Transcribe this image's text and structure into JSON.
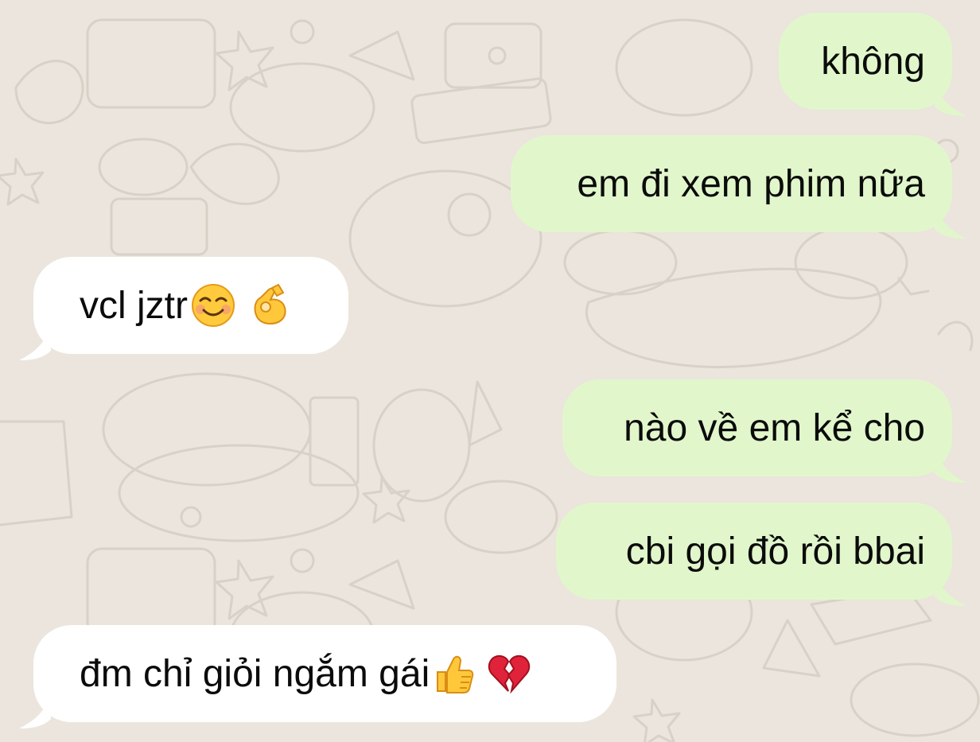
{
  "conversation": {
    "messages": [
      {
        "direction": "outgoing",
        "text": "không"
      },
      {
        "direction": "outgoing",
        "text": "em đi xem phim nữa"
      },
      {
        "direction": "incoming",
        "text": "vcl jztr",
        "emojis": [
          "smiling-face-emoji",
          "ok-hand-emoji"
        ]
      },
      {
        "direction": "outgoing",
        "text": "nào về em kể cho"
      },
      {
        "direction": "outgoing",
        "text": "cbi gọi đồ rồi bbai"
      },
      {
        "direction": "incoming",
        "text": "đm chỉ giỏi ngắm gái",
        "emojis": [
          "thumbs-up-emoji",
          "broken-heart-emoji"
        ]
      }
    ]
  },
  "colors": {
    "background": "#ebe5dd",
    "outgoing_bubble": "#e1f7cb",
    "incoming_bubble": "#ffffff",
    "text": "#0b0b0b"
  }
}
